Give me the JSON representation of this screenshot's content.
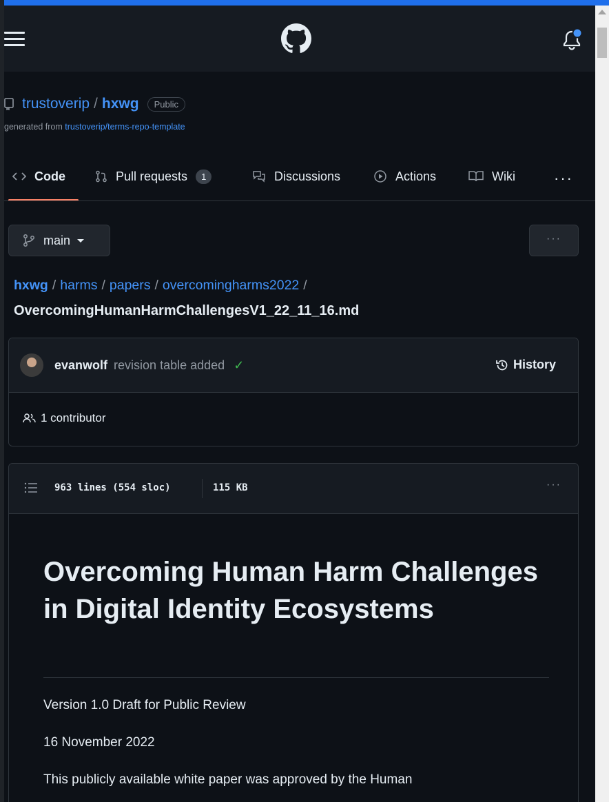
{
  "repo": {
    "owner": "trustoverip",
    "separator": "/",
    "name": "hxwg",
    "visibility": "Public",
    "generated_prefix": "generated from",
    "template": "trustoverip/terms-repo-template"
  },
  "tabs": [
    {
      "label": "Code",
      "icon": "code-icon"
    },
    {
      "label": "Pull requests",
      "icon": "pull-request-icon",
      "count": "1"
    },
    {
      "label": "Discussions",
      "icon": "discussion-icon"
    },
    {
      "label": "Actions",
      "icon": "play-icon"
    },
    {
      "label": "Wiki",
      "icon": "book-icon"
    }
  ],
  "more_tabs": "···",
  "branch": {
    "name": "main"
  },
  "more_button": "···",
  "breadcrumb": {
    "parts": [
      "hxwg",
      "harms",
      "papers",
      "overcomingharms2022"
    ],
    "sep": "/",
    "filename": "OvercomingHumanHarmChallengesV1_22_11_16.md"
  },
  "commit": {
    "author": "evanwolf",
    "message": "revision table added",
    "status_symbol": "✓",
    "history_label": "History",
    "contributors": "1 contributor"
  },
  "file": {
    "lines": "963 lines (554 sloc)",
    "size": "115 KB",
    "more": "···"
  },
  "document": {
    "title": "Overcoming Human Harm Challenges in Digital Identity Ecosystems",
    "version": "Version 1.0 Draft for Public Review",
    "date": "16 November 2022",
    "intro": "This publicly available white paper was approved by the Human"
  },
  "colors": {
    "background": "#0d1117",
    "header": "#161b22",
    "link": "#4493f8",
    "accent_underline": "#f78166",
    "success": "#3fb950",
    "notification_dot": "#4493f8"
  }
}
